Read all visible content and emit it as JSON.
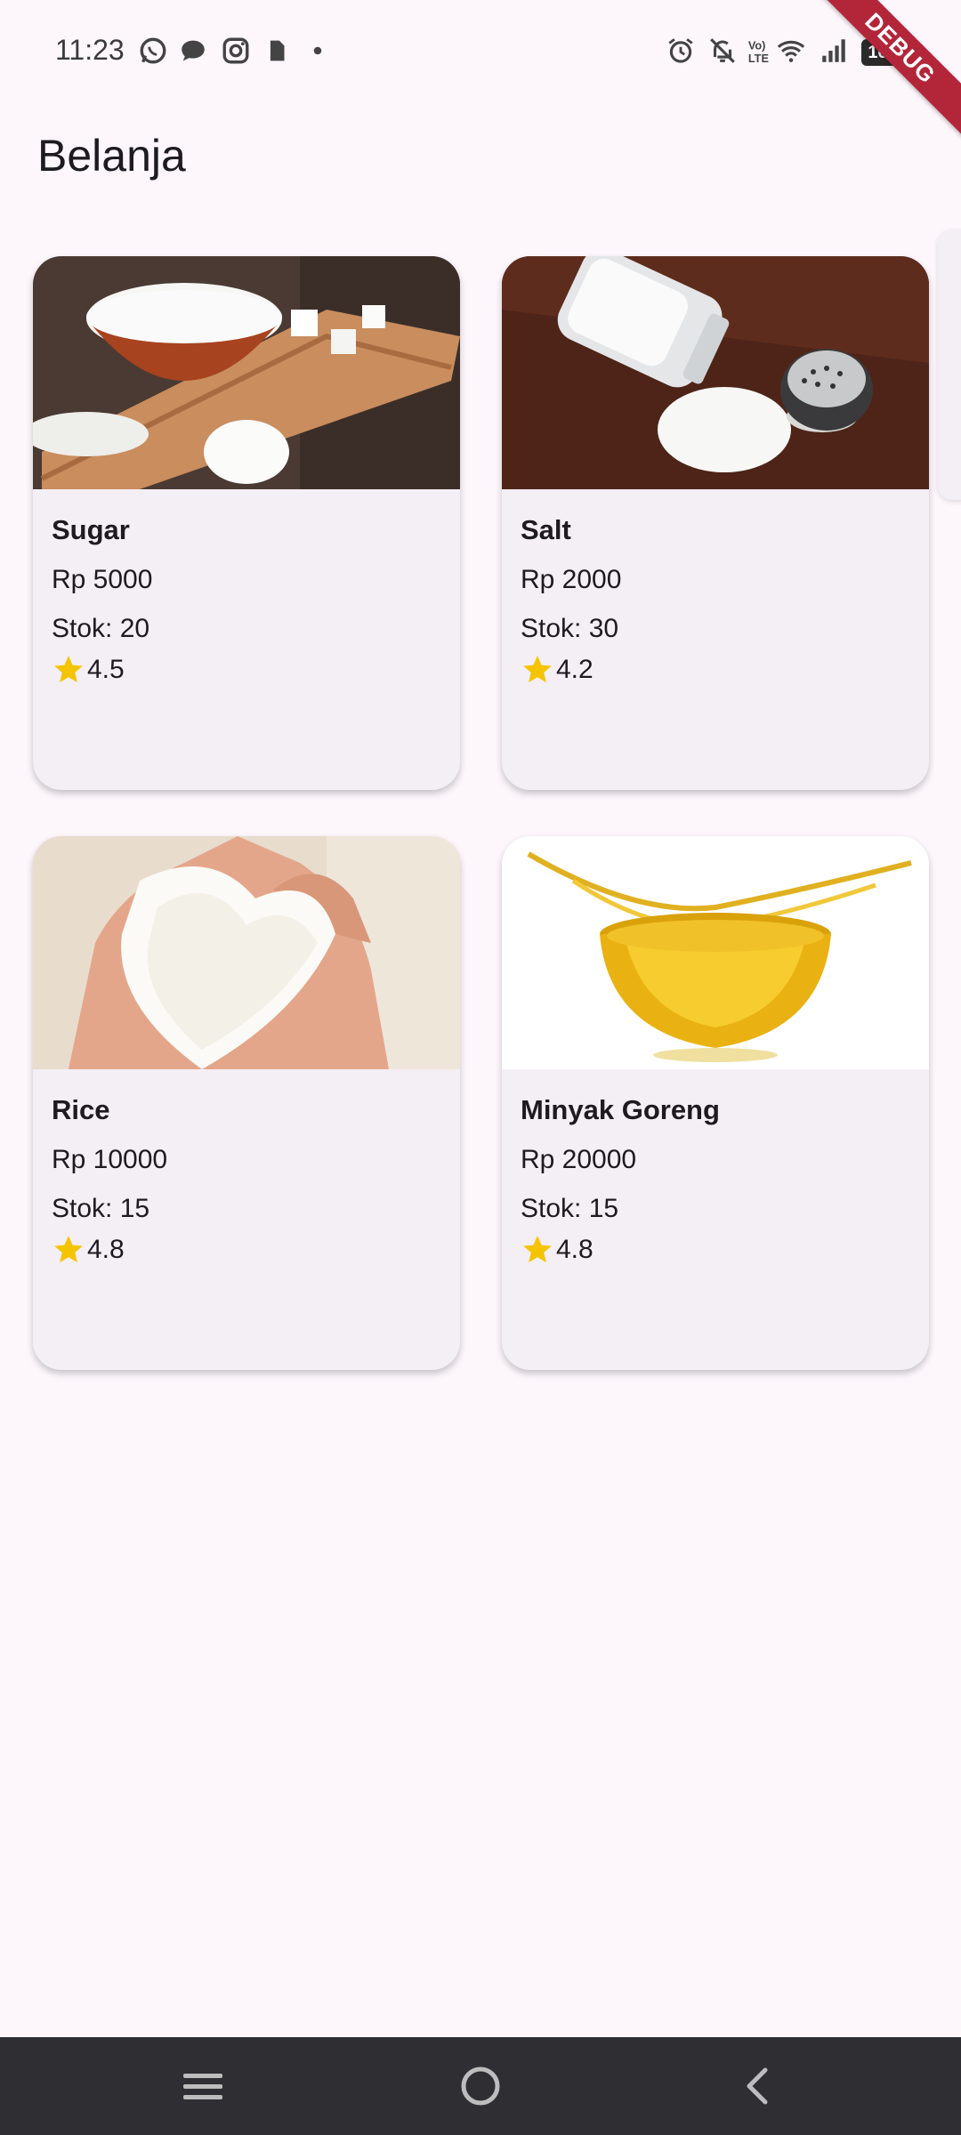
{
  "status_bar": {
    "time": "11:23",
    "battery": "100",
    "left_icons": [
      "whatsapp-icon",
      "message-icon",
      "instagram-icon",
      "sim-icon",
      "dot-icon"
    ],
    "right_icons": [
      "alarm-icon",
      "bell-off-icon",
      "volte-icon",
      "wifi-icon",
      "signal-icon",
      "battery-icon"
    ]
  },
  "debug_banner": "DEBUG",
  "app": {
    "title": "Belanja"
  },
  "products": [
    {
      "name": "Sugar",
      "price": "Rp 5000",
      "stock": "Stok: 20",
      "rating": "4.5",
      "image": "sugar-image"
    },
    {
      "name": "Salt",
      "price": "Rp 2000",
      "stock": "Stok: 30",
      "rating": "4.2",
      "image": "salt-image"
    },
    {
      "name": "Rice",
      "price": "Rp 10000",
      "stock": "Stok: 15",
      "rating": "4.8",
      "image": "rice-image"
    },
    {
      "name": "Minyak Goreng",
      "price": "Rp 20000",
      "stock": "Stok: 15",
      "rating": "4.8",
      "image": "oil-image"
    }
  ],
  "colors": {
    "background": "#fdf7fc",
    "card": "#f4eff5",
    "star": "#f5c400",
    "nav": "#2f2f33"
  },
  "navigation": [
    "menu-icon",
    "home-icon",
    "back-icon"
  ]
}
